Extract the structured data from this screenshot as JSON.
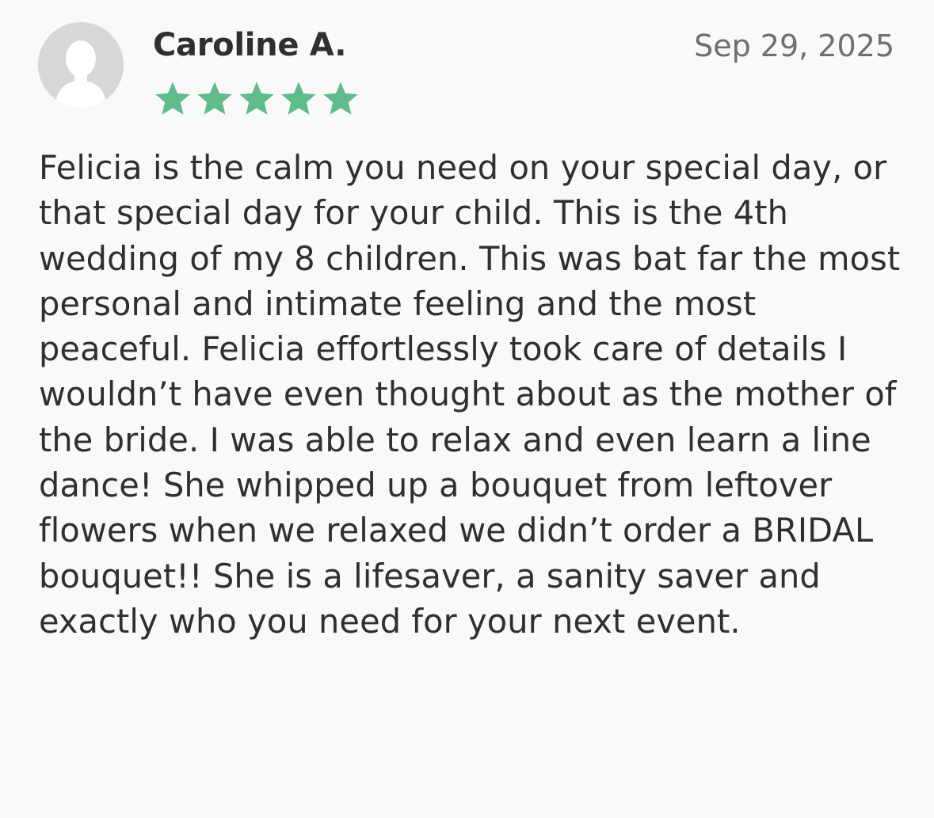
{
  "review": {
    "reviewer_name": "Caroline A.",
    "date": "Sep 29, 2025",
    "rating": 5,
    "rating_max": 5,
    "star_color": "#5fbb8a",
    "avatar_icon": "default-user-avatar-icon",
    "text": "Felicia is the calm you need on your special day, or that special day for your child. This is the 4th wedding of my 8 children. This was bat far the most personal and intimate feeling and the most peaceful. Felicia effortlessly took care of details I wouldn’t have even thought about as the mother of the bride. I was able to relax and even learn a line dance! She whipped up a bouquet from leftover flowers when we relaxed we didn’t order a BRIDAL bouquet!! She is a lifesaver, a sanity saver and exactly who you need for your next event."
  }
}
